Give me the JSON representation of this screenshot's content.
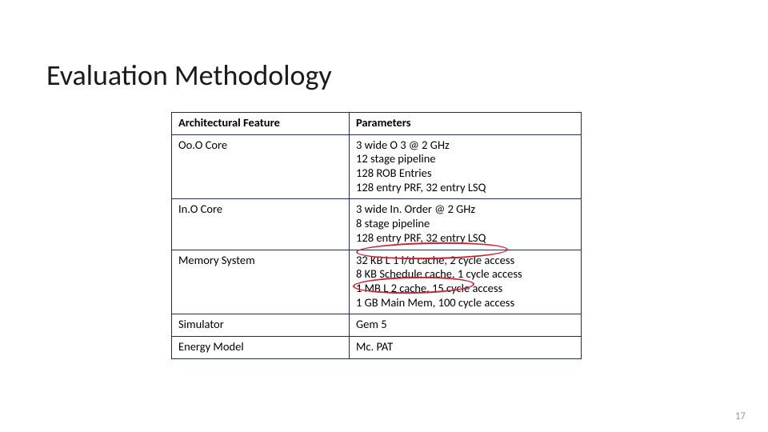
{
  "title": "Evaluation Methodology",
  "header": {
    "c1": "Architectural Feature",
    "c2": "Parameters"
  },
  "rows": [
    {
      "feature": "Oo.O Core",
      "params": [
        "3 wide O 3 @ 2 GHz",
        "12 stage pipeline",
        "128 ROB Entries",
        "128 entry PRF, 32 entry LSQ"
      ]
    },
    {
      "feature": "In.O Core",
      "params": [
        "3 wide In. Order @ 2 GHz",
        "8 stage pipeline",
        "128 entry PRF, 32 entry LSQ"
      ]
    },
    {
      "feature": "Memory System",
      "params": [
        "32 KB L 1 i/d cache, 2 cycle access",
        "8 KB Schedule cache, 1 cycle access",
        "1 MB L 2 cache, 15 cycle access",
        "1 GB Main Mem, 100 cycle access"
      ]
    },
    {
      "feature": "Simulator",
      "params": [
        "Gem 5"
      ]
    },
    {
      "feature": "Energy Model",
      "params": [
        "Mc. PAT"
      ]
    }
  ],
  "page_number": "17"
}
